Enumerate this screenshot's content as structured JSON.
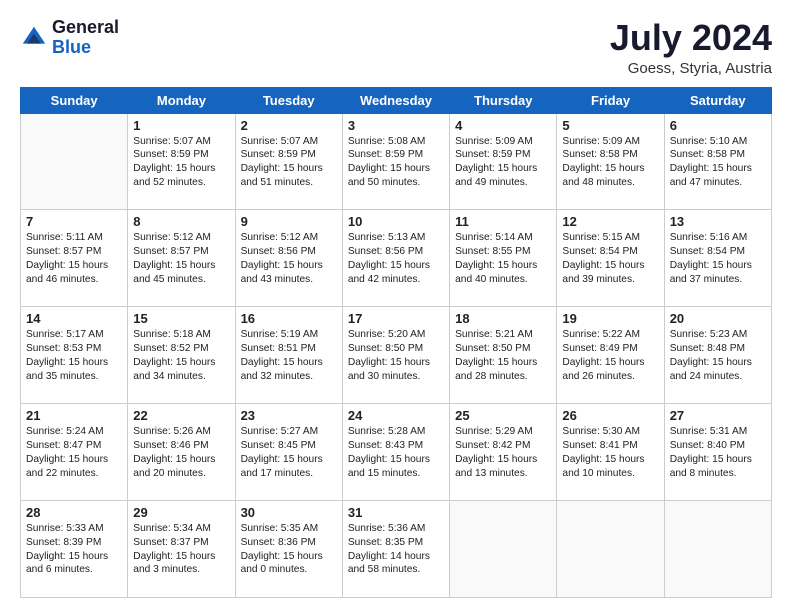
{
  "header": {
    "logo_general": "General",
    "logo_blue": "Blue",
    "month_year": "July 2024",
    "location": "Goess, Styria, Austria"
  },
  "weekdays": [
    "Sunday",
    "Monday",
    "Tuesday",
    "Wednesday",
    "Thursday",
    "Friday",
    "Saturday"
  ],
  "weeks": [
    [
      {
        "day": "",
        "lines": []
      },
      {
        "day": "1",
        "lines": [
          "Sunrise: 5:07 AM",
          "Sunset: 8:59 PM",
          "Daylight: 15 hours",
          "and 52 minutes."
        ]
      },
      {
        "day": "2",
        "lines": [
          "Sunrise: 5:07 AM",
          "Sunset: 8:59 PM",
          "Daylight: 15 hours",
          "and 51 minutes."
        ]
      },
      {
        "day": "3",
        "lines": [
          "Sunrise: 5:08 AM",
          "Sunset: 8:59 PM",
          "Daylight: 15 hours",
          "and 50 minutes."
        ]
      },
      {
        "day": "4",
        "lines": [
          "Sunrise: 5:09 AM",
          "Sunset: 8:59 PM",
          "Daylight: 15 hours",
          "and 49 minutes."
        ]
      },
      {
        "day": "5",
        "lines": [
          "Sunrise: 5:09 AM",
          "Sunset: 8:58 PM",
          "Daylight: 15 hours",
          "and 48 minutes."
        ]
      },
      {
        "day": "6",
        "lines": [
          "Sunrise: 5:10 AM",
          "Sunset: 8:58 PM",
          "Daylight: 15 hours",
          "and 47 minutes."
        ]
      }
    ],
    [
      {
        "day": "7",
        "lines": [
          "Sunrise: 5:11 AM",
          "Sunset: 8:57 PM",
          "Daylight: 15 hours",
          "and 46 minutes."
        ]
      },
      {
        "day": "8",
        "lines": [
          "Sunrise: 5:12 AM",
          "Sunset: 8:57 PM",
          "Daylight: 15 hours",
          "and 45 minutes."
        ]
      },
      {
        "day": "9",
        "lines": [
          "Sunrise: 5:12 AM",
          "Sunset: 8:56 PM",
          "Daylight: 15 hours",
          "and 43 minutes."
        ]
      },
      {
        "day": "10",
        "lines": [
          "Sunrise: 5:13 AM",
          "Sunset: 8:56 PM",
          "Daylight: 15 hours",
          "and 42 minutes."
        ]
      },
      {
        "day": "11",
        "lines": [
          "Sunrise: 5:14 AM",
          "Sunset: 8:55 PM",
          "Daylight: 15 hours",
          "and 40 minutes."
        ]
      },
      {
        "day": "12",
        "lines": [
          "Sunrise: 5:15 AM",
          "Sunset: 8:54 PM",
          "Daylight: 15 hours",
          "and 39 minutes."
        ]
      },
      {
        "day": "13",
        "lines": [
          "Sunrise: 5:16 AM",
          "Sunset: 8:54 PM",
          "Daylight: 15 hours",
          "and 37 minutes."
        ]
      }
    ],
    [
      {
        "day": "14",
        "lines": [
          "Sunrise: 5:17 AM",
          "Sunset: 8:53 PM",
          "Daylight: 15 hours",
          "and 35 minutes."
        ]
      },
      {
        "day": "15",
        "lines": [
          "Sunrise: 5:18 AM",
          "Sunset: 8:52 PM",
          "Daylight: 15 hours",
          "and 34 minutes."
        ]
      },
      {
        "day": "16",
        "lines": [
          "Sunrise: 5:19 AM",
          "Sunset: 8:51 PM",
          "Daylight: 15 hours",
          "and 32 minutes."
        ]
      },
      {
        "day": "17",
        "lines": [
          "Sunrise: 5:20 AM",
          "Sunset: 8:50 PM",
          "Daylight: 15 hours",
          "and 30 minutes."
        ]
      },
      {
        "day": "18",
        "lines": [
          "Sunrise: 5:21 AM",
          "Sunset: 8:50 PM",
          "Daylight: 15 hours",
          "and 28 minutes."
        ]
      },
      {
        "day": "19",
        "lines": [
          "Sunrise: 5:22 AM",
          "Sunset: 8:49 PM",
          "Daylight: 15 hours",
          "and 26 minutes."
        ]
      },
      {
        "day": "20",
        "lines": [
          "Sunrise: 5:23 AM",
          "Sunset: 8:48 PM",
          "Daylight: 15 hours",
          "and 24 minutes."
        ]
      }
    ],
    [
      {
        "day": "21",
        "lines": [
          "Sunrise: 5:24 AM",
          "Sunset: 8:47 PM",
          "Daylight: 15 hours",
          "and 22 minutes."
        ]
      },
      {
        "day": "22",
        "lines": [
          "Sunrise: 5:26 AM",
          "Sunset: 8:46 PM",
          "Daylight: 15 hours",
          "and 20 minutes."
        ]
      },
      {
        "day": "23",
        "lines": [
          "Sunrise: 5:27 AM",
          "Sunset: 8:45 PM",
          "Daylight: 15 hours",
          "and 17 minutes."
        ]
      },
      {
        "day": "24",
        "lines": [
          "Sunrise: 5:28 AM",
          "Sunset: 8:43 PM",
          "Daylight: 15 hours",
          "and 15 minutes."
        ]
      },
      {
        "day": "25",
        "lines": [
          "Sunrise: 5:29 AM",
          "Sunset: 8:42 PM",
          "Daylight: 15 hours",
          "and 13 minutes."
        ]
      },
      {
        "day": "26",
        "lines": [
          "Sunrise: 5:30 AM",
          "Sunset: 8:41 PM",
          "Daylight: 15 hours",
          "and 10 minutes."
        ]
      },
      {
        "day": "27",
        "lines": [
          "Sunrise: 5:31 AM",
          "Sunset: 8:40 PM",
          "Daylight: 15 hours",
          "and 8 minutes."
        ]
      }
    ],
    [
      {
        "day": "28",
        "lines": [
          "Sunrise: 5:33 AM",
          "Sunset: 8:39 PM",
          "Daylight: 15 hours",
          "and 6 minutes."
        ]
      },
      {
        "day": "29",
        "lines": [
          "Sunrise: 5:34 AM",
          "Sunset: 8:37 PM",
          "Daylight: 15 hours",
          "and 3 minutes."
        ]
      },
      {
        "day": "30",
        "lines": [
          "Sunrise: 5:35 AM",
          "Sunset: 8:36 PM",
          "Daylight: 15 hours",
          "and 0 minutes."
        ]
      },
      {
        "day": "31",
        "lines": [
          "Sunrise: 5:36 AM",
          "Sunset: 8:35 PM",
          "Daylight: 14 hours",
          "and 58 minutes."
        ]
      },
      {
        "day": "",
        "lines": []
      },
      {
        "day": "",
        "lines": []
      },
      {
        "day": "",
        "lines": []
      }
    ]
  ]
}
